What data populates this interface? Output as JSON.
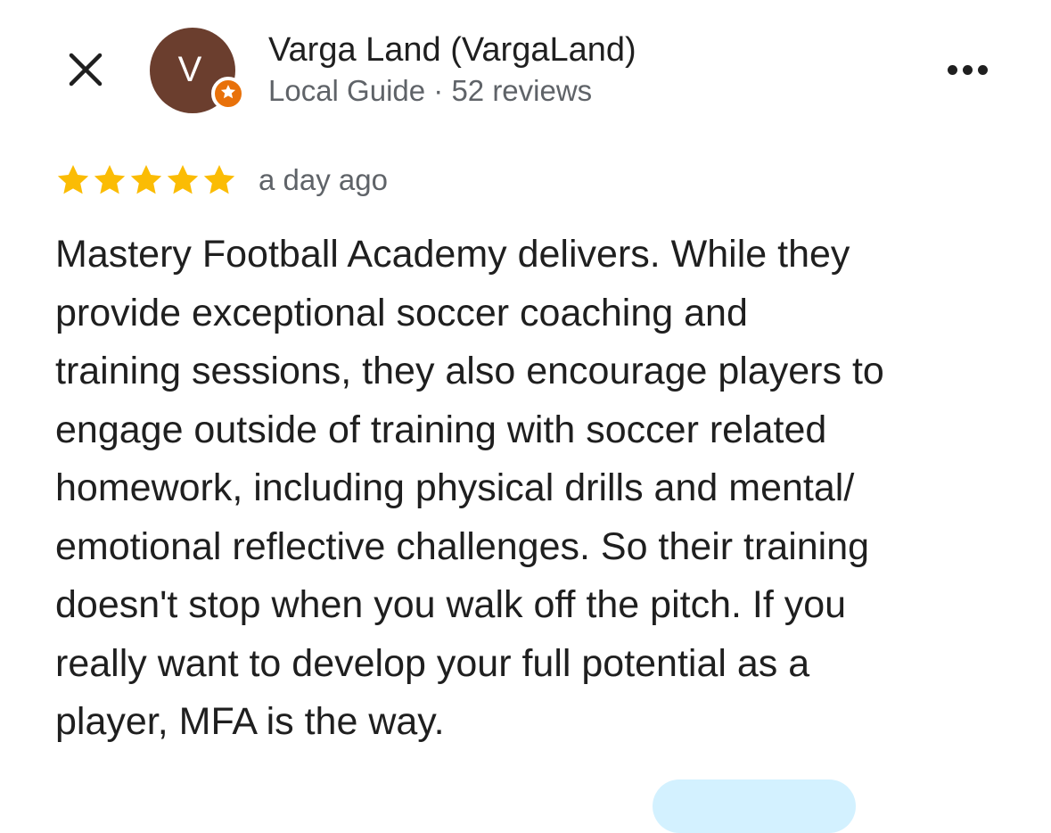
{
  "header": {
    "close_icon": "close-icon",
    "avatar_letter": "V",
    "avatar_color": "#6b3e2e",
    "badge_icon": "star-badge-icon",
    "badge_color": "#e8710a",
    "user_name": "Varga Land (VargaLand)",
    "user_meta": "Local Guide · 52 reviews",
    "more_icon": "more-horizontal-icon"
  },
  "review": {
    "rating": 5,
    "max_rating": 5,
    "star_color": "#fbbc04",
    "time_ago": "a day ago",
    "lines": [
      "Mastery Football Academy delivers. While they",
      "provide exceptional soccer coaching and",
      "training sessions, they also encourage players to",
      "engage outside of training with soccer related",
      "homework, including physical drills and mental/",
      "emotional reflective challenges. So their training",
      "doesn't stop when you walk off the pitch. If you",
      "really want to develop your full potential as a",
      "player, MFA is the way."
    ]
  },
  "bottom_pill_color": "#d3f1ff"
}
